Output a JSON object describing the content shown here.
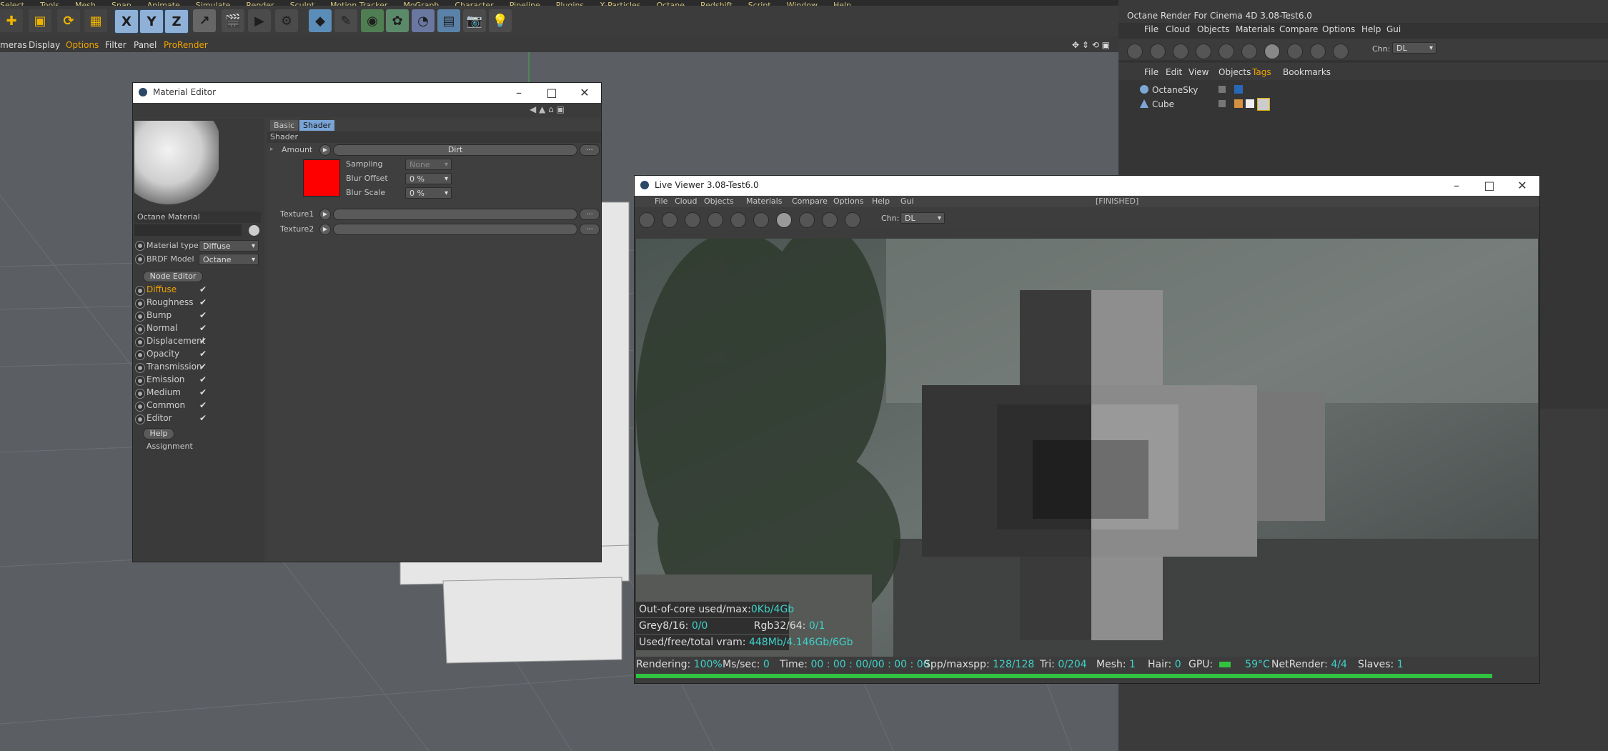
{
  "main_menu": [
    "Select",
    "Tools",
    "Mesh",
    "Snap",
    "Animate",
    "Simulate",
    "Render",
    "Sculpt",
    "Motion Tracker",
    "MoGraph",
    "Character",
    "Pipeline",
    "Plugins",
    "X-Particles",
    "Octane",
    "Redshift",
    "Script",
    "Window",
    "Help"
  ],
  "viewport_menu": {
    "cameras": "meras",
    "display": "Display",
    "options": "Options",
    "filter": "Filter",
    "panel": "Panel",
    "prorender": "ProRender"
  },
  "toolbar": {
    "x": "X",
    "y": "Y",
    "z": "Z"
  },
  "octane_panel": {
    "title": "Octane Render For Cinema 4D 3.08-Test6.0",
    "menu": [
      "File",
      "Cloud",
      "Objects",
      "Materials",
      "Compare",
      "Options",
      "Help",
      "Gui"
    ],
    "chn_label": "Chn:",
    "chn_value": "DL"
  },
  "object_manager": {
    "menu": [
      "File",
      "Edit",
      "View",
      "Objects",
      "Tags",
      "Bookmarks"
    ],
    "objects": [
      {
        "name": "OctaneSky"
      },
      {
        "name": "Cube"
      }
    ]
  },
  "material_editor": {
    "title": "Material Editor",
    "material_name": "Octane Material",
    "material_type_label": "Material type",
    "material_type_value": "Diffuse",
    "brdf_label": "BRDF Model",
    "brdf_value": "Octane",
    "node_editor": "Node Editor",
    "help": "Help",
    "assignment": "Assignment",
    "channels": [
      "Diffuse",
      "Roughness",
      "Bump",
      "Normal",
      "Displacement",
      "Opacity",
      "Transmission",
      "Emission",
      "Medium",
      "Common",
      "Editor"
    ],
    "tabs": {
      "basic": "Basic",
      "shader": "Shader"
    },
    "section": "Shader",
    "amount_label": "Amount",
    "amount_shader": "Dirt",
    "sampling_label": "Sampling",
    "sampling_value": "None",
    "blur_offset_label": "Blur Offset",
    "blur_offset_value": "0 %",
    "blur_scale_label": "Blur Scale",
    "blur_scale_value": "0 %",
    "texture1_label": "Texture1",
    "texture2_label": "Texture2",
    "more_btn": "..."
  },
  "live_viewer": {
    "title": "Live Viewer 3.08-Test6.0",
    "menu": [
      "File",
      "Cloud",
      "Objects",
      "Materials",
      "Compare",
      "Options",
      "Help",
      "Gui"
    ],
    "status_tag": "[FINISHED]",
    "chn_label": "Chn:",
    "chn_value": "DL",
    "overlay_stats": {
      "out_of_core_label": "Out-of-core used/max:",
      "out_of_core_value": "0Kb/4Gb",
      "grey_label": "Grey8/16:",
      "grey_value": "0/0",
      "rgb_label": "Rgb32/64:",
      "rgb_value": "0/1",
      "vram_label": "Used/free/total vram:",
      "vram_value": "448Mb/4.146Gb/6Gb"
    },
    "status": {
      "rendering_label": "Rendering:",
      "rendering_value": "100%",
      "ms_label": "Ms/sec:",
      "ms_value": "0",
      "time_label": "Time:",
      "time_value": "00 : 00 : 00/00 : 00 : 00",
      "spp_label": "Spp/maxspp:",
      "spp_value": "128/128",
      "tri_label": "Tri:",
      "tri_value": "0/204",
      "mesh_label": "Mesh:",
      "mesh_value": "1",
      "hair_label": "Hair:",
      "hair_value": "0",
      "gpu_label": "GPU:",
      "gpu_temp": "59°C",
      "net_label": "NetRender:",
      "net_value": "4/4",
      "slaves_label": "Slaves:",
      "slaves_value": "1"
    },
    "progress_fraction": 1.0
  },
  "colors": {
    "accent_orange": "#f0a400",
    "stat_cyan": "#3fd1c8",
    "progress_green": "#31c23f",
    "shader_swatch": "#ff0000",
    "axis_blue": "#8fb1d8"
  }
}
